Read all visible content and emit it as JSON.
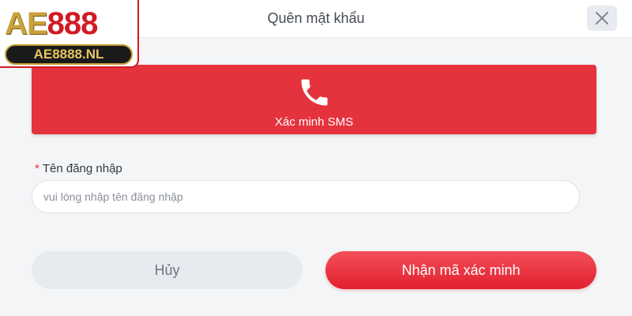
{
  "modal": {
    "title": "Quên mật khẩu"
  },
  "sms_option": {
    "icon": "phone-icon",
    "label": "Xác minh SMS"
  },
  "username_field": {
    "required_mark": "*",
    "label": "Tên đăng nhập",
    "placeholder": "vui lòng nhập tên đăng nhập",
    "value": ""
  },
  "actions": {
    "cancel_label": "Hủy",
    "submit_label": "Nhận mã xác minh"
  },
  "logo": {
    "brand_ae": "AE",
    "brand_num": "888",
    "domain": "AE8888.NL"
  },
  "colors": {
    "accent": "#e5333e",
    "cancel_bg": "#e7ebf0",
    "gold": "#c9a23c"
  }
}
